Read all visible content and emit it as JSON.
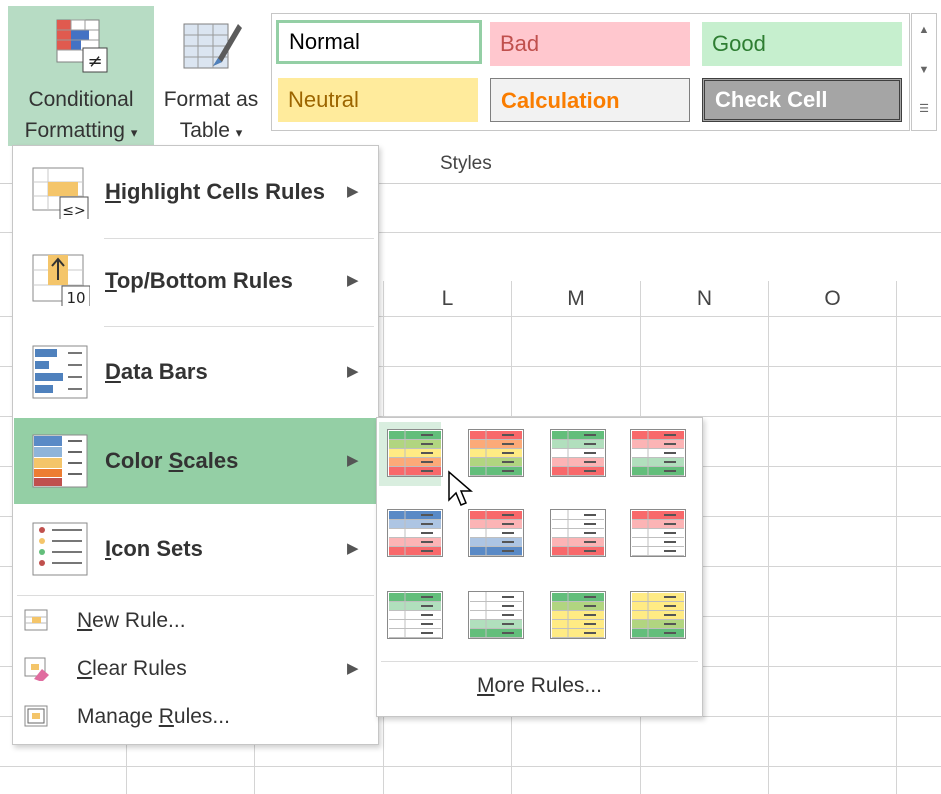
{
  "ribbon": {
    "conditional_formatting": {
      "line1": "Conditional",
      "line2": "Formatting",
      "dropdown": "▾"
    },
    "format_as_table": {
      "line1": "Format as",
      "line2": "Table",
      "dropdown": "▾"
    },
    "styles_group_label": "Styles",
    "cell_styles": [
      {
        "label": "Normal",
        "bg": "#ffffff",
        "fg": "#000000"
      },
      {
        "label": "Bad",
        "bg": "#ffc7ce",
        "fg": "#c0504d"
      },
      {
        "label": "Good",
        "bg": "#c6efce",
        "fg": "#2e7d32"
      },
      {
        "label": "Neutral",
        "bg": "#ffeb9c",
        "fg": "#9c6500"
      },
      {
        "label": "Calculation",
        "bg": "#f2f2f2",
        "fg": "#fa7d00"
      },
      {
        "label": "Check Cell",
        "bg": "#a5a5a5",
        "fg": "#ffffff"
      }
    ]
  },
  "sheet": {
    "columns": [
      "L",
      "M",
      "N",
      "O"
    ]
  },
  "menu": {
    "items": [
      {
        "pre": "",
        "key": "H",
        "post": "ighlight Cells Rules",
        "icon": "highlight-cells-icon",
        "has_submenu": true
      },
      {
        "pre": "",
        "key": "T",
        "post": "op/Bottom Rules",
        "icon": "top-bottom-icon",
        "has_submenu": true
      },
      {
        "pre": "",
        "key": "D",
        "post": "ata Bars",
        "icon": "data-bars-icon",
        "has_submenu": true
      },
      {
        "pre": "Color ",
        "key": "S",
        "post": "cales",
        "icon": "color-scales-icon",
        "has_submenu": true
      },
      {
        "pre": "",
        "key": "I",
        "post": "con Sets",
        "icon": "icon-sets-icon",
        "has_submenu": true
      }
    ],
    "small_items": [
      {
        "pre": "",
        "key": "N",
        "post": "ew Rule...",
        "icon": "new-rule-icon"
      },
      {
        "pre": "",
        "key": "C",
        "post": "lear Rules",
        "icon": "clear-rules-icon",
        "has_submenu": true
      },
      {
        "pre": "Manage ",
        "key": "R",
        "post": "ules...",
        "icon": "manage-rules-icon"
      }
    ],
    "arrow": "▶"
  },
  "submenu": {
    "more_rules": {
      "pre": "",
      "key": "M",
      "post": "ore Rules..."
    },
    "scales": [
      [
        "#63be7b",
        "#ffeb84",
        "#f8696b"
      ],
      [
        "#f8696b",
        "#ffeb84",
        "#63be7b"
      ],
      [
        "#63be7b",
        "#ffffff",
        "#f8696b"
      ],
      [
        "#f8696b",
        "#ffffff",
        "#63be7b"
      ],
      [
        "#5a8ac6",
        "#ffffff",
        "#f8696b"
      ],
      [
        "#f8696b",
        "#ffffff",
        "#5a8ac6"
      ],
      [
        "#ffffff",
        "#ffffff",
        "#f8696b"
      ],
      [
        "#f8696b",
        "#ffffff",
        "#ffffff"
      ],
      [
        "#63be7b",
        "#ffffff",
        "#ffffff"
      ],
      [
        "#ffffff",
        "#ffffff",
        "#63be7b"
      ],
      [
        "#63be7b",
        "#ffeb84",
        "#ffeb84"
      ],
      [
        "#ffeb84",
        "#ffeb84",
        "#63be7b"
      ]
    ]
  }
}
